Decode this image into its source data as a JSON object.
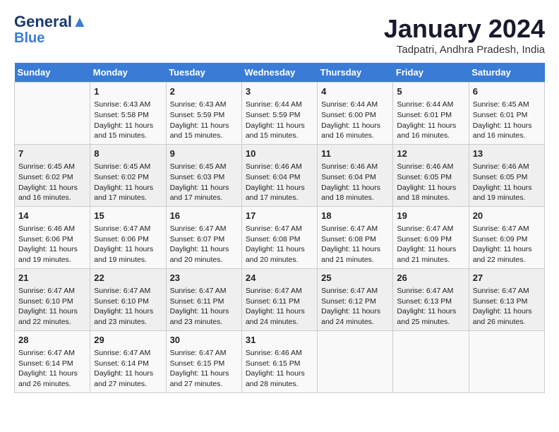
{
  "header": {
    "logo_general": "General",
    "logo_blue": "Blue",
    "month_year": "January 2024",
    "location": "Tadpatri, Andhra Pradesh, India"
  },
  "days_of_week": [
    "Sunday",
    "Monday",
    "Tuesday",
    "Wednesday",
    "Thursday",
    "Friday",
    "Saturday"
  ],
  "weeks": [
    [
      {
        "day": "",
        "info": ""
      },
      {
        "day": "1",
        "info": "Sunrise: 6:43 AM\nSunset: 5:58 PM\nDaylight: 11 hours and 15 minutes."
      },
      {
        "day": "2",
        "info": "Sunrise: 6:43 AM\nSunset: 5:59 PM\nDaylight: 11 hours and 15 minutes."
      },
      {
        "day": "3",
        "info": "Sunrise: 6:44 AM\nSunset: 5:59 PM\nDaylight: 11 hours and 15 minutes."
      },
      {
        "day": "4",
        "info": "Sunrise: 6:44 AM\nSunset: 6:00 PM\nDaylight: 11 hours and 16 minutes."
      },
      {
        "day": "5",
        "info": "Sunrise: 6:44 AM\nSunset: 6:01 PM\nDaylight: 11 hours and 16 minutes."
      },
      {
        "day": "6",
        "info": "Sunrise: 6:45 AM\nSunset: 6:01 PM\nDaylight: 11 hours and 16 minutes."
      }
    ],
    [
      {
        "day": "7",
        "info": "Sunrise: 6:45 AM\nSunset: 6:02 PM\nDaylight: 11 hours and 16 minutes."
      },
      {
        "day": "8",
        "info": "Sunrise: 6:45 AM\nSunset: 6:02 PM\nDaylight: 11 hours and 17 minutes."
      },
      {
        "day": "9",
        "info": "Sunrise: 6:45 AM\nSunset: 6:03 PM\nDaylight: 11 hours and 17 minutes."
      },
      {
        "day": "10",
        "info": "Sunrise: 6:46 AM\nSunset: 6:04 PM\nDaylight: 11 hours and 17 minutes."
      },
      {
        "day": "11",
        "info": "Sunrise: 6:46 AM\nSunset: 6:04 PM\nDaylight: 11 hours and 18 minutes."
      },
      {
        "day": "12",
        "info": "Sunrise: 6:46 AM\nSunset: 6:05 PM\nDaylight: 11 hours and 18 minutes."
      },
      {
        "day": "13",
        "info": "Sunrise: 6:46 AM\nSunset: 6:05 PM\nDaylight: 11 hours and 19 minutes."
      }
    ],
    [
      {
        "day": "14",
        "info": "Sunrise: 6:46 AM\nSunset: 6:06 PM\nDaylight: 11 hours and 19 minutes."
      },
      {
        "day": "15",
        "info": "Sunrise: 6:47 AM\nSunset: 6:06 PM\nDaylight: 11 hours and 19 minutes."
      },
      {
        "day": "16",
        "info": "Sunrise: 6:47 AM\nSunset: 6:07 PM\nDaylight: 11 hours and 20 minutes."
      },
      {
        "day": "17",
        "info": "Sunrise: 6:47 AM\nSunset: 6:08 PM\nDaylight: 11 hours and 20 minutes."
      },
      {
        "day": "18",
        "info": "Sunrise: 6:47 AM\nSunset: 6:08 PM\nDaylight: 11 hours and 21 minutes."
      },
      {
        "day": "19",
        "info": "Sunrise: 6:47 AM\nSunset: 6:09 PM\nDaylight: 11 hours and 21 minutes."
      },
      {
        "day": "20",
        "info": "Sunrise: 6:47 AM\nSunset: 6:09 PM\nDaylight: 11 hours and 22 minutes."
      }
    ],
    [
      {
        "day": "21",
        "info": "Sunrise: 6:47 AM\nSunset: 6:10 PM\nDaylight: 11 hours and 22 minutes."
      },
      {
        "day": "22",
        "info": "Sunrise: 6:47 AM\nSunset: 6:10 PM\nDaylight: 11 hours and 23 minutes."
      },
      {
        "day": "23",
        "info": "Sunrise: 6:47 AM\nSunset: 6:11 PM\nDaylight: 11 hours and 23 minutes."
      },
      {
        "day": "24",
        "info": "Sunrise: 6:47 AM\nSunset: 6:11 PM\nDaylight: 11 hours and 24 minutes."
      },
      {
        "day": "25",
        "info": "Sunrise: 6:47 AM\nSunset: 6:12 PM\nDaylight: 11 hours and 24 minutes."
      },
      {
        "day": "26",
        "info": "Sunrise: 6:47 AM\nSunset: 6:13 PM\nDaylight: 11 hours and 25 minutes."
      },
      {
        "day": "27",
        "info": "Sunrise: 6:47 AM\nSunset: 6:13 PM\nDaylight: 11 hours and 26 minutes."
      }
    ],
    [
      {
        "day": "28",
        "info": "Sunrise: 6:47 AM\nSunset: 6:14 PM\nDaylight: 11 hours and 26 minutes."
      },
      {
        "day": "29",
        "info": "Sunrise: 6:47 AM\nSunset: 6:14 PM\nDaylight: 11 hours and 27 minutes."
      },
      {
        "day": "30",
        "info": "Sunrise: 6:47 AM\nSunset: 6:15 PM\nDaylight: 11 hours and 27 minutes."
      },
      {
        "day": "31",
        "info": "Sunrise: 6:46 AM\nSunset: 6:15 PM\nDaylight: 11 hours and 28 minutes."
      },
      {
        "day": "",
        "info": ""
      },
      {
        "day": "",
        "info": ""
      },
      {
        "day": "",
        "info": ""
      }
    ]
  ]
}
